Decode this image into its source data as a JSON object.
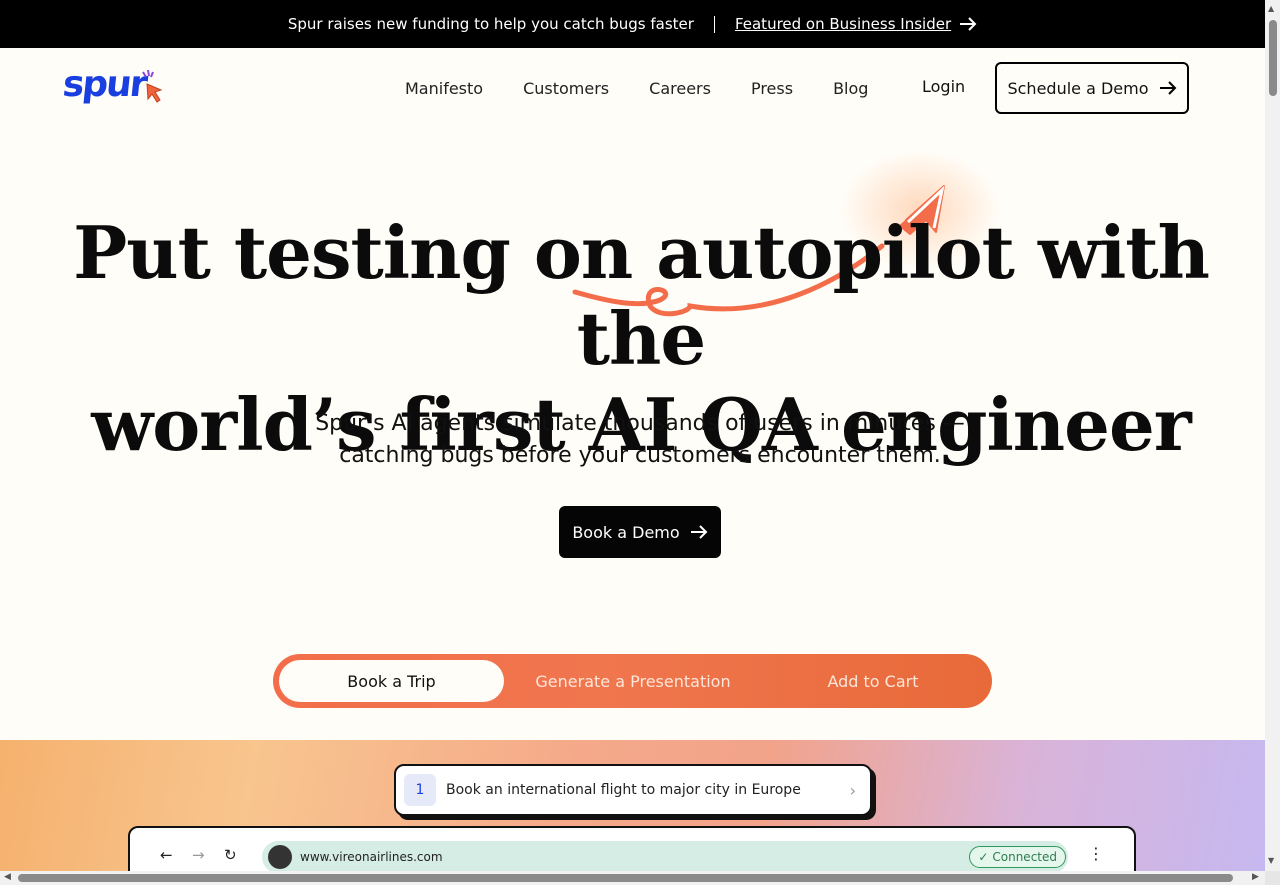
{
  "announcement": {
    "text": "Spur raises new funding to help you catch bugs faster",
    "link_label": "Featured on Business Insider"
  },
  "nav": {
    "logo": "spur",
    "links": [
      "Manifesto",
      "Customers",
      "Careers",
      "Press",
      "Blog"
    ],
    "login": "Login",
    "cta": "Schedule a Demo"
  },
  "hero": {
    "title_line1": "Put testing on autopilot with the",
    "title_line2": "world’s first AI QA engineer",
    "subtitle_line1": "Spur’s AI agents simulate thousands of users in minutes —",
    "subtitle_line2": "catching bugs before your customers encounter them.",
    "cta": "Book a Demo"
  },
  "tabs": [
    {
      "label": "Book a Trip",
      "active": true
    },
    {
      "label": "Generate a Presentation",
      "active": false
    },
    {
      "label": "Add to Cart",
      "active": false
    }
  ],
  "demo": {
    "task_number": "1",
    "task_text": "Book an international flight to major city in Europe",
    "url": "www.vireonairlines.com",
    "status": "Connected"
  },
  "colors": {
    "accent": "#f36d4a",
    "brand_blue": "#1a3fe0",
    "connected_green": "#2e9a5c"
  }
}
